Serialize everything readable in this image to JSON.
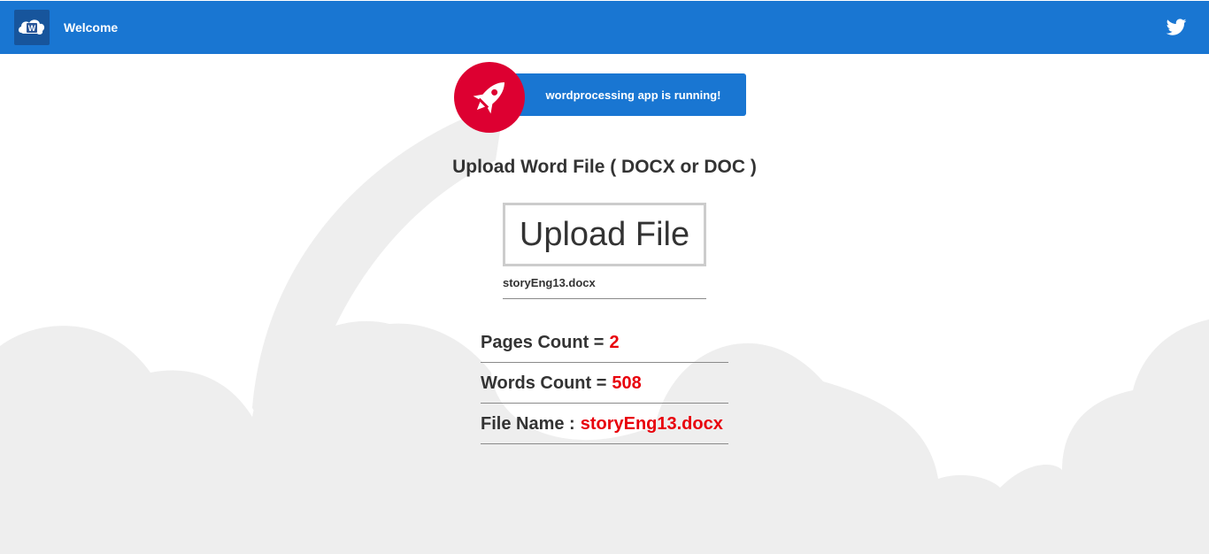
{
  "colors": {
    "toolbar_bg": "#1976d2",
    "rocket_bg": "#dd0031",
    "banner_bg": "#1976d2",
    "cloud": "#eeeeee",
    "value_text": "#e8000b"
  },
  "toolbar": {
    "logo_icon": "word-cloud-logo",
    "title": "Welcome",
    "twitter_icon": "twitter-bird"
  },
  "banner": {
    "rocket_icon": "rocket",
    "text": "wordprocessing app is running!"
  },
  "upload": {
    "heading": "Upload Word File ( DOCX or DOC )",
    "button_label": "Upload File",
    "selected_file": "storyEng13.docx"
  },
  "stats": [
    {
      "label": "Pages Count =",
      "value": "2"
    },
    {
      "label": "Words Count =",
      "value": "508"
    },
    {
      "label": "File Name :",
      "value": "storyEng13.docx"
    }
  ]
}
